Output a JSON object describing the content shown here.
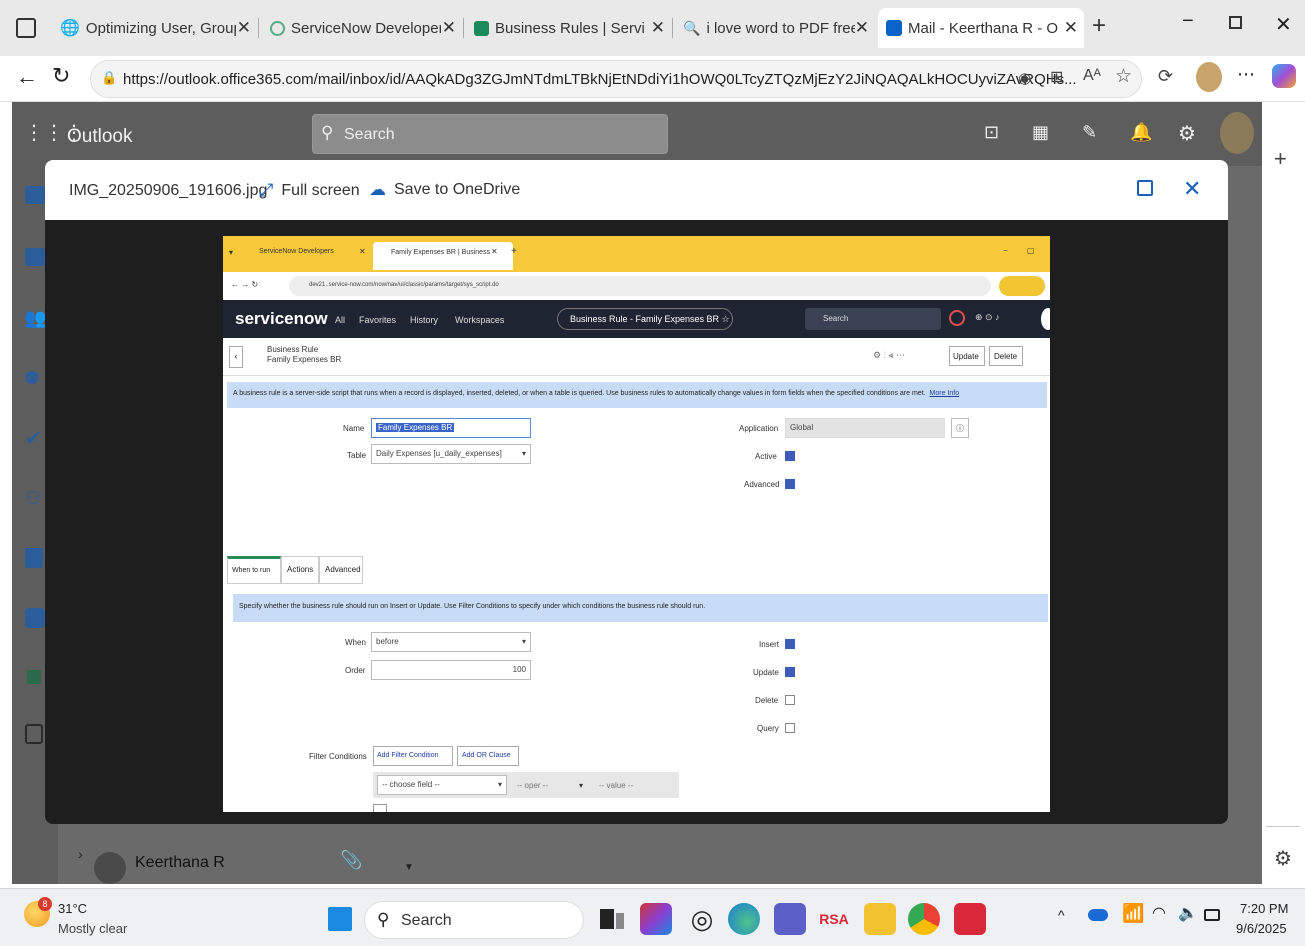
{
  "browser": {
    "tabs": [
      {
        "title": "Optimizing User, Group, ar"
      },
      {
        "title": "ServiceNow Developers"
      },
      {
        "title": "Business Rules | ServiceNo"
      },
      {
        "title": "i love word to PDF free - S"
      },
      {
        "title": "Mail - Keerthana R - Outlo"
      }
    ],
    "url": "https://outlook.office365.com/mail/inbox/id/AAQkADg3ZGJmNTdmLTBkNjEtNDdiYi1hOWQ0LTcyZTQzMjEzY2JiNQAQALkHOCUyviZAvRQHs..."
  },
  "outlook": {
    "app_name": "Outlook",
    "search_placeholder": "Search",
    "sender_name": "Keerthana R"
  },
  "viewer": {
    "filename": "IMG_20250906_191606.jpg",
    "fullscreen_label": "Full screen",
    "save_label": "Save to OneDrive"
  },
  "snapshot": {
    "tab1": "ServiceNow Developers",
    "tab2": "Family Expenses BR | Business",
    "url": "dev21..service-now.com/now/nav/ui/classic/params/target/sys_script.do",
    "logo": "servicenow",
    "nav": [
      "All",
      "Favorites",
      "History",
      "Workspaces"
    ],
    "record_pill": "Business Rule - Family Expenses BR ☆",
    "search": "Search",
    "form_type": "Business Rule",
    "form_name": "Family Expenses BR",
    "update_btn": "Update",
    "delete_btn": "Delete",
    "info": "A business rule is a server-side script that runs when a record is displayed, inserted, deleted, or when a table is queried. Use business rules to automatically change values in form fields when the specified conditions are met.",
    "more_info": "More Info",
    "name_label": "Name",
    "name_value": "Family Expenses BR",
    "table_label": "Table",
    "table_value": "Daily Expenses [u_daily_expenses]",
    "app_label": "Application",
    "app_value": "Global",
    "active_label": "Active",
    "advanced_label": "Advanced",
    "tabs": [
      "When to run",
      "Actions",
      "Advanced"
    ],
    "when_info": "Specify whether the business rule should run on Insert or Update. Use Filter Conditions to specify under which conditions the business rule should run.",
    "when_label": "When",
    "when_value": "before",
    "order_label": "Order",
    "order_value": "100",
    "insert_label": "Insert",
    "update_label": "Update",
    "delete_label": "Delete",
    "query_label": "Query",
    "filter_label": "Filter Conditions",
    "add_filter": "Add Filter Condition",
    "add_or": "Add OR Clause",
    "choose_field": "-- choose field --",
    "oper": "-- oper --",
    "value": "-- value --"
  },
  "taskbar": {
    "temp": "31°C",
    "weather": "Mostly clear",
    "search": "Search",
    "time": "7:20 PM",
    "date": "9/6/2025",
    "weather_badge": "8"
  }
}
